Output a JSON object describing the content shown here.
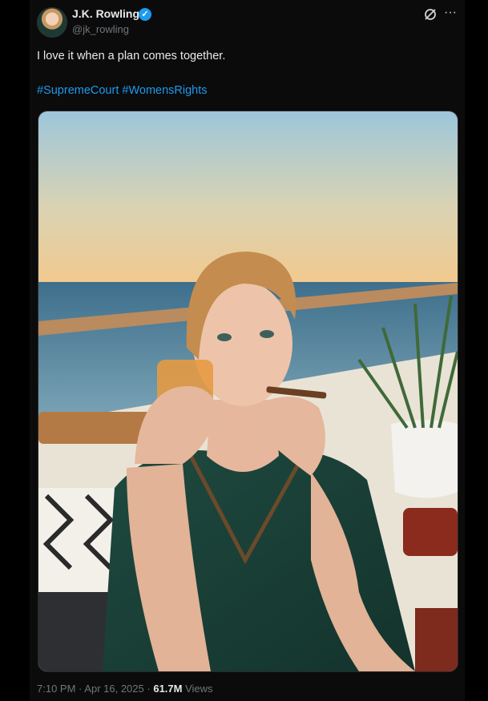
{
  "tweet": {
    "author_name": "J.K. Rowling",
    "author_handle": "@jk_rowling",
    "text": "I love it when a plan comes together.",
    "hashtags": [
      "#SupremeCourt",
      "#WomensRights"
    ],
    "time": "7:10 PM",
    "date": "Apr 16, 2025",
    "separator": "·",
    "views_count": "61.7M",
    "views_label": "Views"
  },
  "icons": {
    "verified": "verified-badge-icon",
    "grok": "grok-icon",
    "more": "more-options-icon"
  },
  "colors": {
    "accent": "#1d9bf0",
    "background": "#000000",
    "muted": "#71767b"
  }
}
